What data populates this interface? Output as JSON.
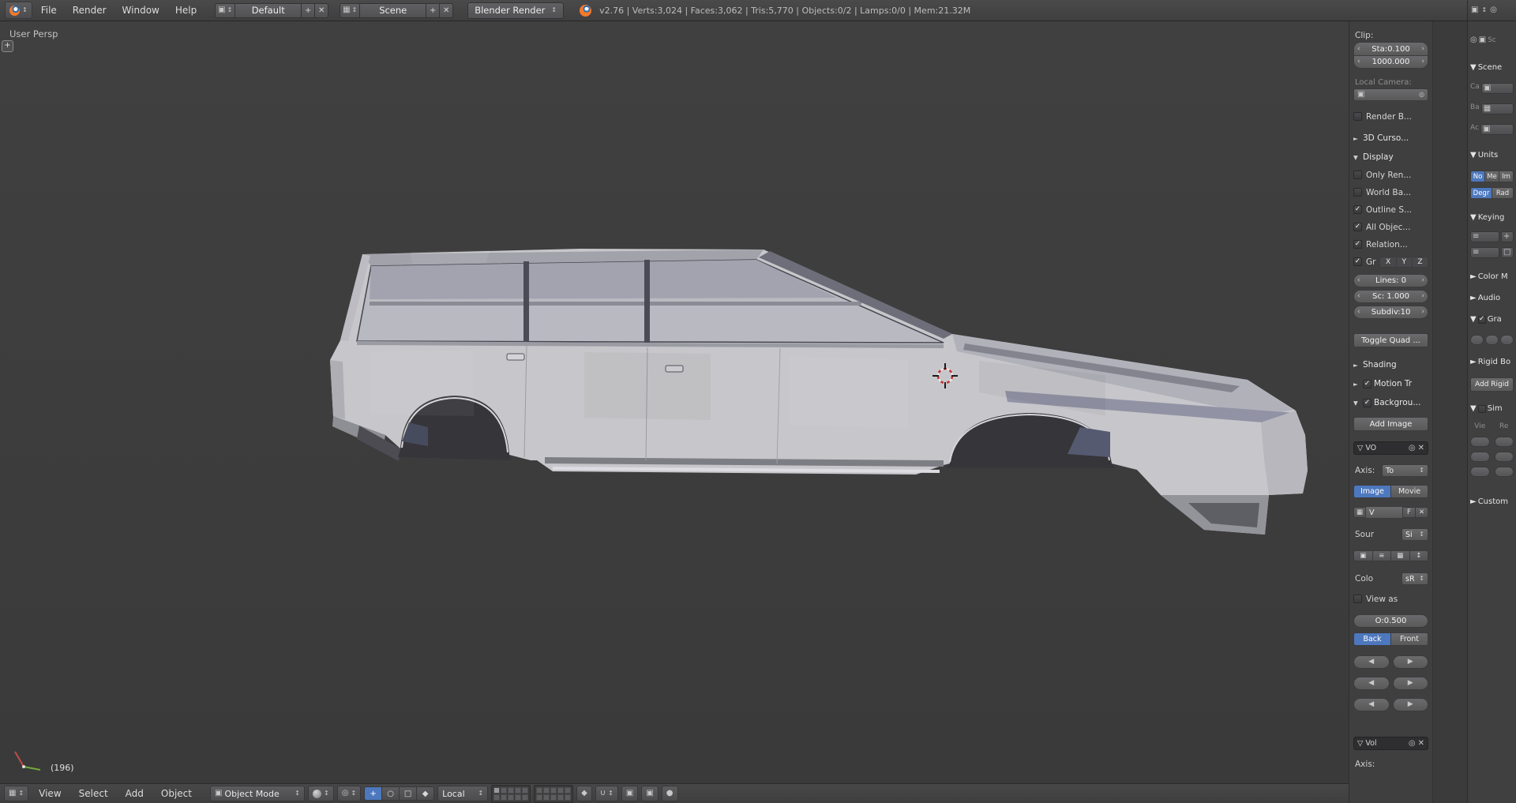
{
  "glyphs": {
    "tri_down": "▼",
    "tri_right": "►",
    "tri_open": "▽",
    "check": "✓",
    "close": "✕",
    "chev_l": "‹",
    "chev_r": "›",
    "tri_l": "◀",
    "tri_r": "▶",
    "updown": "↕",
    "plus": "+",
    "dot": "●",
    "ring": "○",
    "box": "▦",
    "sq": "▣",
    "target": "◎",
    "diamond": "◆",
    "magnet": "∪",
    "square": "□",
    "bars": "≡"
  },
  "topbar": {
    "menus": [
      "File",
      "Render",
      "Window",
      "Help"
    ],
    "layout": "Default",
    "scene": "Scene",
    "engine": "Blender Render",
    "stats": "v2.76 | Verts:3,024 | Faces:3,062 | Tris:5,770 | Objects:0/2 | Lamps:0/0 | Mem:21.32M"
  },
  "viewport": {
    "view_label": "User Persp",
    "frame_label": "(196)"
  },
  "bottombar": {
    "menus": [
      "View",
      "Select",
      "Add",
      "Object"
    ],
    "mode": "Object Mode",
    "orientation": "Local"
  },
  "npanel": {
    "clip_label": "Clip:",
    "clip_start": "Sta:0.100",
    "clip_end": "1000.000",
    "local_camera_label": "Local Camera:",
    "render_border": "Render B...",
    "cursor_panel": "3D Curso...",
    "display_panel": "Display",
    "only_render": "Only Ren...",
    "world_background": "World Ba...",
    "outline_selected": "Outline S...",
    "all_object_origins": "All Objec...",
    "relationship_lines": "Relation...",
    "grid_floor": "Gr",
    "axis_x": "X",
    "axis_y": "Y",
    "axis_z": "Z",
    "grid_lines": "Lines: 0",
    "grid_scale": "Sc: 1.000",
    "grid_subdiv": "Subdiv:10",
    "toggle_quad": "Toggle Quad ...",
    "shading_panel": "Shading",
    "motion_panel": "Motion Tr",
    "background_panel": "Backgrou...",
    "add_image": "Add Image",
    "image_item": "VO",
    "axis_label": "Axis:",
    "axis_value": "To",
    "image_toggle": "Image",
    "movie_toggle": "Movie",
    "datablock_value": "V",
    "fake_user": "F",
    "source_label": "Sour",
    "source_value": "Si",
    "color_label": "Colo",
    "color_value": "sR",
    "view_as": "View as",
    "opacity": "O:0.500",
    "back_toggle": "Back",
    "front_toggle": "Front",
    "volume_item": "Vol",
    "axis_label2": "Axis:"
  },
  "props": {
    "context_label": "Sc",
    "scene_panel": "Scene",
    "camera_label": "Ca",
    "background_label": "Ba",
    "clip_label": "Ac",
    "units_panel": "Units",
    "unit_none": "No",
    "unit_metric": "Me",
    "unit_imperial": "Im",
    "unit_degrees": "Degr",
    "unit_radians": "Rad",
    "keying_panel": "Keying",
    "colorm_panel": "Color M",
    "audio_panel": "Audio",
    "gravity_panel": "Gra",
    "rigidbody_panel": "Rigid Bo",
    "add_rigid": "Add Rigid",
    "simplify_panel": "Sim",
    "viewport_col": "Vie",
    "render_col": "Re",
    "custom_panel": "Custom"
  }
}
